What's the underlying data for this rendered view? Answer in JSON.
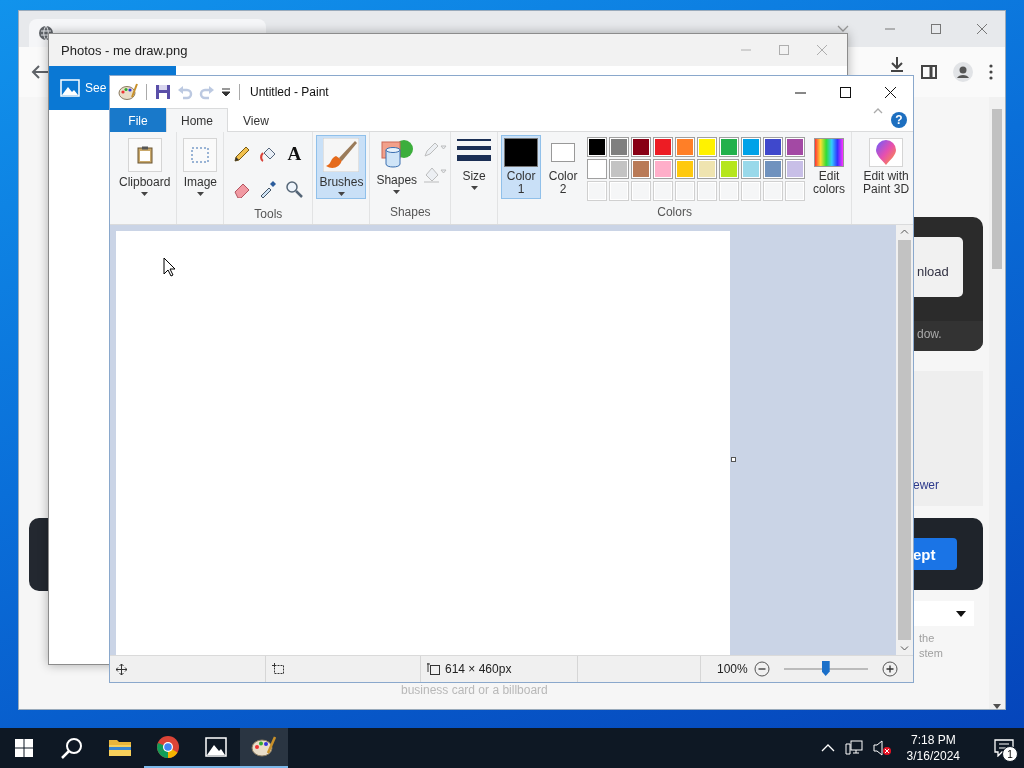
{
  "browser_window": {
    "page": {
      "download_card": {
        "button_label": "nload",
        "footer_text": "dow."
      },
      "info_panel": {
        "link": "ewer"
      },
      "consent_card": {
        "button_label": "ept"
      },
      "footnote": [
        "the",
        "stem"
      ],
      "caption": "business card or a billboard"
    }
  },
  "photos_window": {
    "title": "Photos - me draw.png",
    "nav_label": "See"
  },
  "paint_window": {
    "title": "Untitled - Paint",
    "quick_access": [
      {
        "kind": "save",
        "disabled": false
      },
      {
        "kind": "undo",
        "disabled": true
      },
      {
        "kind": "redo",
        "disabled": true
      }
    ],
    "ribbon_tabs": [
      {
        "label": "File",
        "kind": "menu",
        "selected": false
      },
      {
        "label": "Home",
        "kind": "tab",
        "selected": true
      },
      {
        "label": "View",
        "kind": "tab",
        "selected": false
      }
    ],
    "help_label": "?",
    "clipboard": {
      "label": "Clipboard"
    },
    "image": {
      "label": "Image"
    },
    "tools": {
      "label": "Tools",
      "items": [
        {
          "kind": "pencil",
          "selected": false
        },
        {
          "kind": "fill",
          "selected": false
        },
        {
          "kind": "text",
          "glyph": "A",
          "selected": false
        },
        {
          "kind": "eraser",
          "selected": false
        },
        {
          "kind": "picker",
          "selected": false
        },
        {
          "kind": "magnifier",
          "selected": false
        }
      ]
    },
    "brushes": {
      "label": "Brushes",
      "selected": true
    },
    "shapes": {
      "button_label": "Shapes",
      "group_label": "Shapes",
      "options": [
        {
          "kind": "outline",
          "disabled": true
        },
        {
          "kind": "fill",
          "disabled": true
        }
      ]
    },
    "size": {
      "label": "Size"
    },
    "colors": {
      "group_label": "Colors",
      "color1": {
        "label": "Color 1",
        "color": "#000000",
        "selected": true
      },
      "color2": {
        "label": "Color 2",
        "color": "#ffffff",
        "selected": false
      },
      "palette": [
        [
          {
            "kind": "color",
            "color": "#000000"
          },
          {
            "kind": "color",
            "color": "#7f7f7f"
          },
          {
            "kind": "color",
            "color": "#880015"
          },
          {
            "kind": "color",
            "color": "#ed1c24"
          },
          {
            "kind": "color",
            "color": "#ff7f27"
          },
          {
            "kind": "color",
            "color": "#fff200"
          },
          {
            "kind": "color",
            "color": "#22b14c"
          },
          {
            "kind": "color",
            "color": "#00a2e8"
          },
          {
            "kind": "color",
            "color": "#3f48cc"
          },
          {
            "kind": "color",
            "color": "#a349a4"
          }
        ],
        [
          {
            "kind": "color",
            "color": "#ffffff"
          },
          {
            "kind": "color",
            "color": "#c3c3c3"
          },
          {
            "kind": "color",
            "color": "#b97a57"
          },
          {
            "kind": "color",
            "color": "#ffaec9"
          },
          {
            "kind": "color",
            "color": "#ffc90e"
          },
          {
            "kind": "color",
            "color": "#efe4b0"
          },
          {
            "kind": "color",
            "color": "#b5e61d"
          },
          {
            "kind": "color",
            "color": "#99d9ea"
          },
          {
            "kind": "color",
            "color": "#7092be"
          },
          {
            "kind": "color",
            "color": "#c8bfe7"
          }
        ],
        [
          {
            "kind": "empty"
          },
          {
            "kind": "empty"
          },
          {
            "kind": "empty"
          },
          {
            "kind": "empty"
          },
          {
            "kind": "empty"
          },
          {
            "kind": "empty"
          },
          {
            "kind": "empty"
          },
          {
            "kind": "empty"
          },
          {
            "kind": "empty"
          },
          {
            "kind": "empty"
          }
        ]
      ],
      "edit_label": "Edit colors"
    },
    "paint3d": {
      "label": "Edit with Paint 3D"
    },
    "status_bar": {
      "canvas_size": "614 × 460px",
      "zoom": "100%",
      "zoom_slider": {
        "level": 0.5
      }
    }
  },
  "taskbar": {
    "apps": [
      {
        "kind": "folder",
        "running": false,
        "selected": false
      },
      {
        "kind": "browser",
        "running": true,
        "selected": false
      },
      {
        "kind": "photos",
        "running": true,
        "selected": false
      },
      {
        "kind": "paint",
        "running": true,
        "selected": true
      }
    ],
    "volume": {
      "muted": true
    },
    "clock": {
      "time": "7:18 PM",
      "date": "3/16/2024"
    },
    "notifications": {
      "badge": "1"
    }
  }
}
